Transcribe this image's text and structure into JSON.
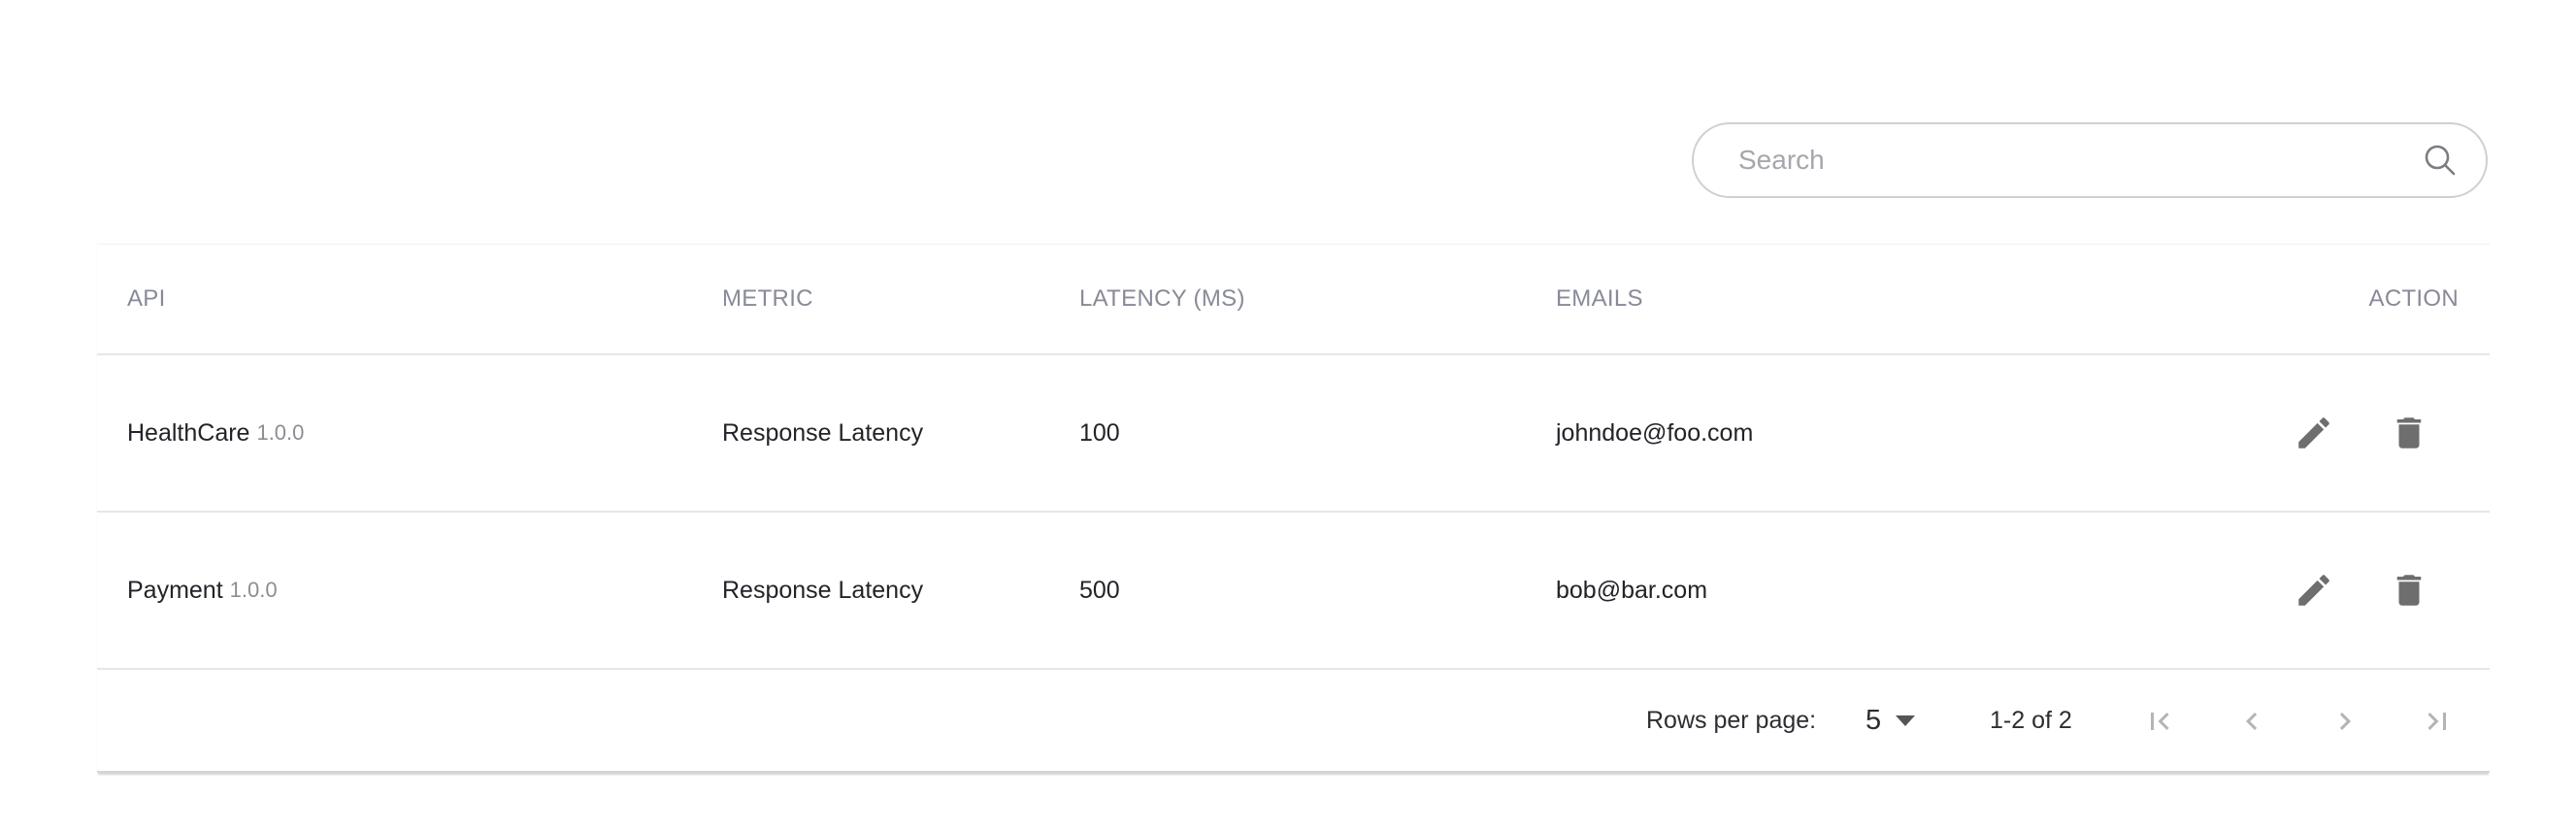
{
  "search": {
    "placeholder": "Search"
  },
  "table": {
    "headers": {
      "api": "API",
      "metric": "METRIC",
      "latency": "LATENCY (MS)",
      "emails": "EMAILS",
      "action": "ACTION"
    },
    "rows": [
      {
        "api": "HealthCare",
        "version": "1.0.0",
        "metric": "Response Latency",
        "latency": "100",
        "email": "johndoe@foo.com"
      },
      {
        "api": "Payment",
        "version": "1.0.0",
        "metric": "Response Latency",
        "latency": "500",
        "email": "bob@bar.com"
      }
    ]
  },
  "pagination": {
    "rows_per_page_label": "Rows per page:",
    "rows_per_page_value": "5",
    "range": "1-2 of 2"
  },
  "icons": {
    "search": "search-icon",
    "edit": "pencil-icon",
    "delete": "trash-icon",
    "dropdown": "caret-down-icon",
    "first": "first-page-icon",
    "prev": "chevron-left-icon",
    "next": "chevron-right-icon",
    "last": "last-page-icon"
  },
  "colors": {
    "header_text": "#888a98",
    "icon": "#6e6e6e",
    "nav_disabled": "#b4b4b8",
    "version_text": "#8d8d95"
  }
}
